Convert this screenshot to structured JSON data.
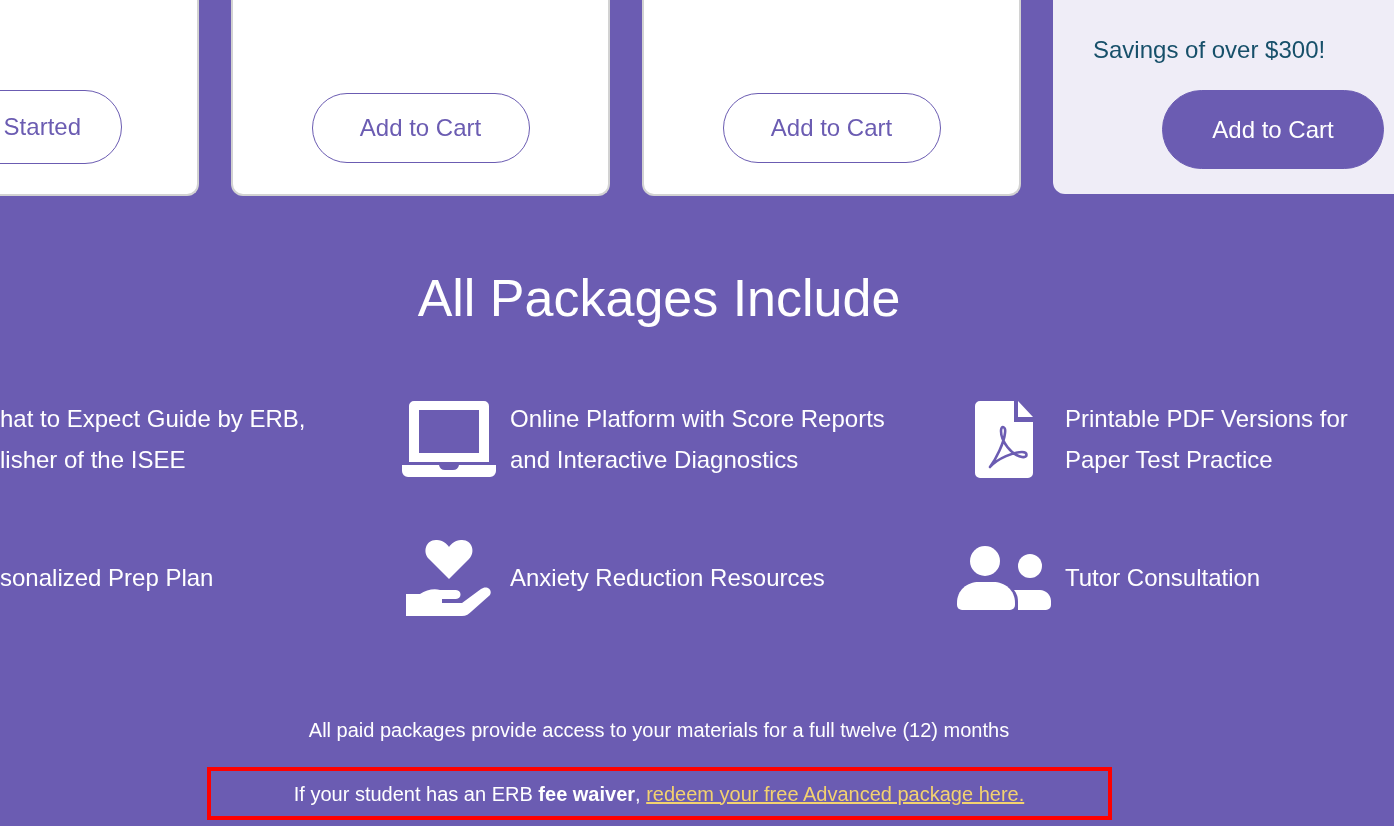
{
  "pricing_cards": [
    {
      "featured": false,
      "button": "Started"
    },
    {
      "featured": false,
      "button": "Add to Cart"
    },
    {
      "featured": false,
      "button": "Add to Cart"
    },
    {
      "featured": true,
      "note": "Savings of over $300!",
      "button": "Add to Cart"
    }
  ],
  "includes": {
    "heading": "All Packages Include",
    "features": [
      {
        "kind": "text",
        "lines": [
          "hat to Expect Guide by ERB,",
          "lisher of the ISEE"
        ]
      },
      {
        "kind": "laptop",
        "lines": [
          "Online Platform with Score Reports",
          "and Interactive Diagnostics"
        ]
      },
      {
        "kind": "pdf",
        "lines": [
          "Printable PDF Versions for",
          "Paper Test Practice"
        ]
      },
      {
        "kind": "text",
        "lines": [
          "sonalized Prep Plan"
        ]
      },
      {
        "kind": "heart-hand",
        "lines": [
          "Anxiety Reduction Resources"
        ]
      },
      {
        "kind": "people",
        "lines": [
          "Tutor Consultation"
        ]
      }
    ]
  },
  "access_note": "All paid packages provide access to your materials for a full twelve (12) months",
  "fee_waiver": {
    "highlighted": true,
    "text": "If your student has an ERB **fee waiver**,",
    "link": "redeem your free Advanced package here."
  }
}
